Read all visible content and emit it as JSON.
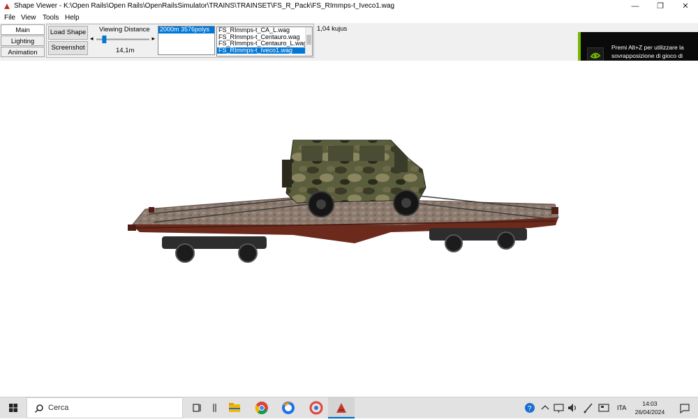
{
  "window": {
    "title": "Shape Viewer - K:\\Open Rails\\Open Rails\\OpenRailsSimulator\\TRAINS\\TRAINSET\\FS_R_Pack\\FS_RImmps-t_Iveco1.wag",
    "minimize": "—",
    "restore": "❐",
    "close": "✕"
  },
  "menu": [
    "File",
    "View",
    "Tools",
    "Help"
  ],
  "tabs": [
    "Main",
    "Lighting",
    "Animation"
  ],
  "toolbar": {
    "load_shape": "Load Shape",
    "screenshot": "Screenshot",
    "viewing_distance_label": "Viewing Distance",
    "viewing_distance_value": "14,1m",
    "slider_left": "◂",
    "slider_right": "▸",
    "slider_level": 0.12,
    "lod_items": [
      "2000m 3576polys"
    ],
    "wagon_files": [
      "FS_RImmps-t_CA_L.wag",
      "FS_RImmps-t_Centauro.wag",
      "FS_RImmps-t_Centauro_L.wag",
      "FS_RImmps-t_Iveco1.wag"
    ],
    "selected_wagon_index": 3,
    "size_readout": "1,04 kujus"
  },
  "overlay": {
    "text": "Premi Alt+Z per utilizzare la sovrapposizione di gioco di GeForce Experience"
  },
  "taskbar": {
    "search_placeholder": "Cerca",
    "language": "ITA",
    "time": "14:03",
    "date": "26/04/2024"
  },
  "colors": {
    "selection": "#0078d7",
    "nvidia_green": "#76b900",
    "wagon_frame": "#6b2a1c",
    "deck": "#8c7a6e"
  }
}
